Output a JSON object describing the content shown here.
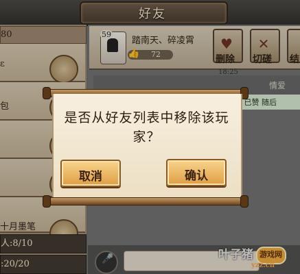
{
  "header": {
    "title": "好友"
  },
  "friend_list": {
    "header_value": "80",
    "rows": [
      {
        "name": "ɛ",
        "action_icon": "arrow-hand-icon"
      },
      {
        "name": "包",
        "action_icon": "arrow-hand-icon"
      },
      {
        "name": "",
        "action_icon": "arrow-hand-icon"
      },
      {
        "name": "",
        "action_icon": "arrow-hand-icon"
      },
      {
        "name": "十月墨笔",
        "action_icon": "arrow-hand-icon"
      }
    ],
    "footer_counts": [
      "人:8/10",
      ":20/20"
    ]
  },
  "profile": {
    "level": "59",
    "name": "踏南天、碎凌霄",
    "likes": "72"
  },
  "actions": [
    {
      "label": "删除",
      "icon": "broken-heart-icon"
    },
    {
      "label": "切磋",
      "icon": "crossed-swords-icon"
    },
    {
      "label": "结",
      "icon": "bond-icon"
    }
  ],
  "chat": {
    "time": "18:25",
    "sender": "情爱",
    "message": "大佬 已赞 随后"
  },
  "dialog": {
    "question": "是否从好友列表中移除该玩家？",
    "cancel_label": "取消",
    "confirm_label": "确认"
  },
  "watermark": {
    "text": "叶子猪",
    "badge": "游戏网",
    "sub": "yzz.cn"
  },
  "colors": {
    "button_fill": "#efb964",
    "paper": "#f2e7d0",
    "frame": "#6c4521"
  }
}
